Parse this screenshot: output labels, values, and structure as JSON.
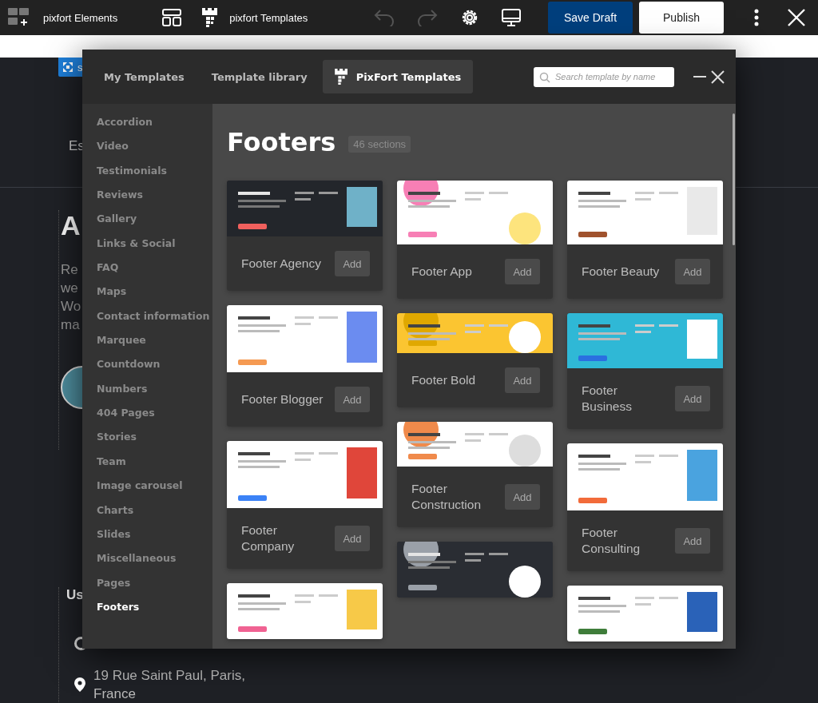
{
  "toolbar": {
    "elements_label": "pixfort Elements",
    "templates_label": "pixfort Templates",
    "undo": {
      "disabled": true
    },
    "redo": {
      "disabled": true
    },
    "save_draft": "Save Draft",
    "publish": "Publish"
  },
  "page": {
    "badge": "s",
    "intro": "Es",
    "heading": "A",
    "paragraph": [
      "Re",
      "we",
      "Wo",
      "ma"
    ],
    "subheading": "Us",
    "address": [
      "19 Rue Saint Paul, Paris,",
      "France"
    ]
  },
  "modal": {
    "tabs": [
      {
        "label": "My Templates",
        "selected": false
      },
      {
        "label": "Template library",
        "selected": false
      },
      {
        "label": "PixFort Templates",
        "selected": true
      }
    ],
    "search": {
      "placeholder": "Search template by name"
    },
    "categories": [
      {
        "label": "Accordion",
        "selected": false
      },
      {
        "label": "Video",
        "selected": false
      },
      {
        "label": "Testimonials",
        "selected": false
      },
      {
        "label": "Reviews",
        "selected": false
      },
      {
        "label": "Gallery",
        "selected": false
      },
      {
        "label": "Links & Social",
        "selected": false
      },
      {
        "label": "FAQ",
        "selected": false
      },
      {
        "label": "Maps",
        "selected": false
      },
      {
        "label": "Contact information",
        "selected": false
      },
      {
        "label": "Marquee",
        "selected": false
      },
      {
        "label": "Countdown",
        "selected": false
      },
      {
        "label": "Numbers",
        "selected": false
      },
      {
        "label": "404 Pages",
        "selected": false
      },
      {
        "label": "Stories",
        "selected": false
      },
      {
        "label": "Team",
        "selected": false
      },
      {
        "label": "Image carousel",
        "selected": false
      },
      {
        "label": "Charts",
        "selected": false
      },
      {
        "label": "Slides",
        "selected": false
      },
      {
        "label": "Miscellaneous",
        "selected": false
      },
      {
        "label": "Pages",
        "selected": false
      },
      {
        "label": "Footers",
        "selected": true
      }
    ],
    "heading": "Footers",
    "count": "46 sections",
    "templates": [
      {
        "preview": {
          "kind": "picture"
        },
        "name": "Footer Agency",
        "button": "Add"
      },
      {
        "preview": {
          "kind": "picture"
        },
        "name": "Footer App",
        "button": "Add"
      },
      {
        "preview": {
          "kind": "picture"
        },
        "name": "Footer Beauty",
        "button": "Add"
      },
      {
        "preview": {
          "kind": "picture"
        },
        "name": "Footer Blogger",
        "button": "Add"
      },
      {
        "preview": {
          "kind": "picture"
        },
        "name": "Footer Bold",
        "button": "Add"
      },
      {
        "preview": {
          "kind": "picture"
        },
        "name": "Footer Business",
        "button": "Add"
      },
      {
        "preview": {
          "kind": "picture"
        },
        "name": "Footer Company",
        "button": "Add"
      },
      {
        "preview": {
          "kind": "picture"
        },
        "name": "Footer Construction",
        "button": "Add"
      },
      {
        "preview": {
          "kind": "picture"
        },
        "name": "Footer Consulting",
        "button": "Add"
      },
      {
        "preview": {
          "kind": "picture"
        }
      },
      {
        "preview": {
          "kind": "picture"
        }
      },
      {
        "preview": {
          "kind": "picture"
        }
      }
    ]
  }
}
